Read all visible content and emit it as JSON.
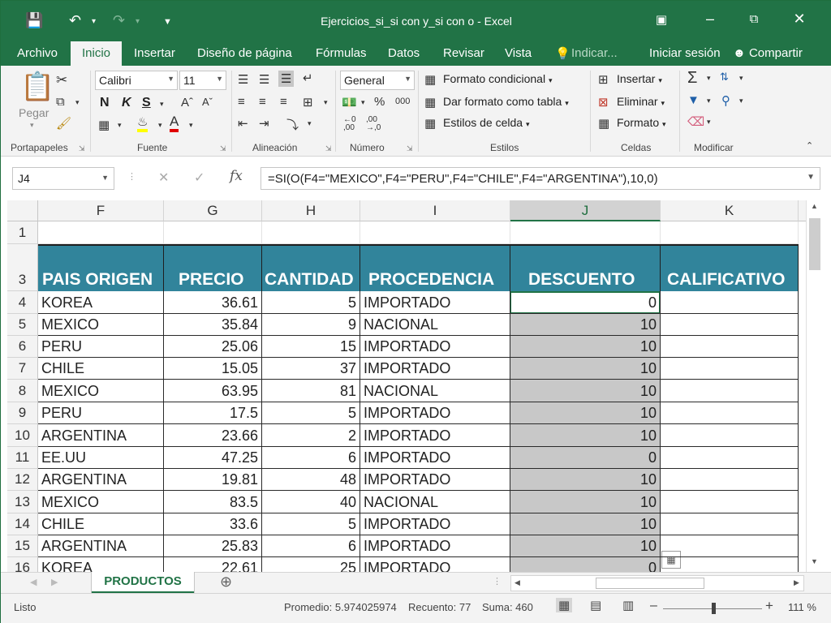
{
  "window": {
    "title": "Ejercicios_si_si con y_si con o - Excel",
    "colors": {
      "brand": "#217346",
      "header_fill": "#31849b",
      "selection_fill": "#c8c8c8"
    }
  },
  "tabs": [
    {
      "label": "Archivo"
    },
    {
      "label": "Inicio",
      "active": true
    },
    {
      "label": "Insertar"
    },
    {
      "label": "Diseño de página"
    },
    {
      "label": "Fórmulas"
    },
    {
      "label": "Datos"
    },
    {
      "label": "Revisar"
    },
    {
      "label": "Vista"
    },
    {
      "label": "Indicar..."
    }
  ],
  "account": {
    "signin": "Iniciar sesión",
    "share": "Compartir"
  },
  "ribbon": {
    "clipboard": {
      "paste": "Pegar",
      "label": "Portapapeles"
    },
    "font": {
      "name": "Calibri",
      "size": "11",
      "bold": "N",
      "italic": "K",
      "underline": "S",
      "label": "Fuente"
    },
    "alignment": {
      "label": "Alineación"
    },
    "number": {
      "format": "General",
      "label": "Número"
    },
    "styles": {
      "conditional": "Formato condicional",
      "as_table": "Dar formato como tabla",
      "cell_styles": "Estilos de celda",
      "label": "Estilos"
    },
    "cells": {
      "insert": "Insertar",
      "delete": "Eliminar",
      "format": "Formato",
      "label": "Celdas"
    },
    "editing": {
      "label": "Modificar"
    }
  },
  "formula_bar": {
    "name_box": "J4",
    "formula": "=SI(O(F4=\"MEXICO\",F4=\"PERU\",F4=\"CHILE\",F4=\"ARGENTINA\"),10,0)"
  },
  "columns": [
    "F",
    "G",
    "H",
    "I",
    "J",
    "K"
  ],
  "headers": [
    "PAIS ORIGEN",
    "PRECIO",
    "CANTIDAD",
    "PROCEDENCIA",
    "DESCUENTO",
    "CALIFICATIVO"
  ],
  "rows": [
    {
      "n": "1"
    },
    {
      "n": "3"
    },
    {
      "n": "4",
      "cells": [
        "KOREA",
        "36.61",
        "5",
        "IMPORTADO",
        "0",
        ""
      ]
    },
    {
      "n": "5",
      "cells": [
        "MEXICO",
        "35.84",
        "9",
        "NACIONAL",
        "10",
        ""
      ]
    },
    {
      "n": "6",
      "cells": [
        "PERU",
        "25.06",
        "15",
        "IMPORTADO",
        "10",
        ""
      ]
    },
    {
      "n": "7",
      "cells": [
        "CHILE",
        "15.05",
        "37",
        "IMPORTADO",
        "10",
        ""
      ]
    },
    {
      "n": "8",
      "cells": [
        "MEXICO",
        "63.95",
        "81",
        "NACIONAL",
        "10",
        ""
      ]
    },
    {
      "n": "9",
      "cells": [
        "PERU",
        "17.5",
        "5",
        "IMPORTADO",
        "10",
        ""
      ]
    },
    {
      "n": "10",
      "cells": [
        "ARGENTINA",
        "23.66",
        "2",
        "IMPORTADO",
        "10",
        ""
      ]
    },
    {
      "n": "11",
      "cells": [
        "EE.UU",
        "47.25",
        "6",
        "IMPORTADO",
        "0",
        ""
      ]
    },
    {
      "n": "12",
      "cells": [
        "ARGENTINA",
        "19.81",
        "48",
        "IMPORTADO",
        "10",
        ""
      ]
    },
    {
      "n": "13",
      "cells": [
        "MEXICO",
        "83.5",
        "40",
        "NACIONAL",
        "10",
        ""
      ]
    },
    {
      "n": "14",
      "cells": [
        "CHILE",
        "33.6",
        "5",
        "IMPORTADO",
        "10",
        ""
      ]
    },
    {
      "n": "15",
      "cells": [
        "ARGENTINA",
        "25.83",
        "6",
        "IMPORTADO",
        "10",
        ""
      ]
    },
    {
      "n": "16",
      "cells": [
        "KOREA",
        "22.61",
        "25",
        "IMPORTADO",
        "0",
        ""
      ]
    }
  ],
  "sheet_tabs": [
    {
      "label": "PRODUCTOS",
      "active": true
    }
  ],
  "status": {
    "ready": "Listo",
    "average": "Promedio: 5.974025974",
    "count": "Recuento: 77",
    "sum": "Suma: 460",
    "zoom": "111 %"
  }
}
